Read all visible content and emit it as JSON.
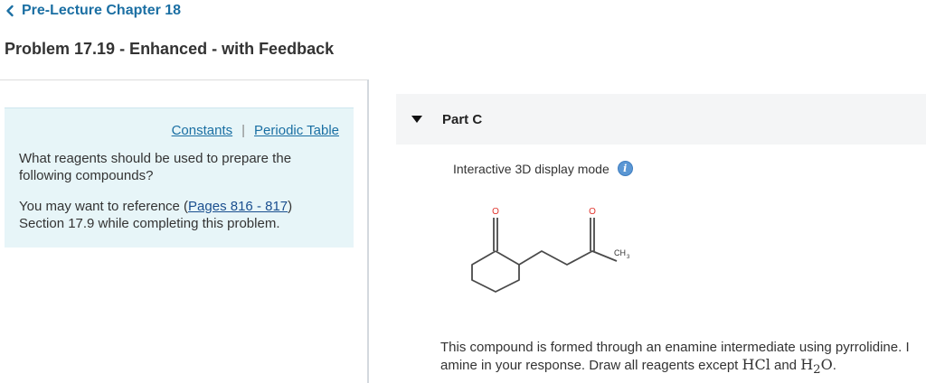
{
  "nav": {
    "back_label": "Pre-Lecture Chapter 18"
  },
  "page": {
    "title": "Problem 17.19 - Enhanced - with Feedback"
  },
  "info_panel": {
    "links": {
      "constants": "Constants",
      "separator": "|",
      "periodic_table": "Periodic Table"
    },
    "question": "What reagents should be used to prepare the following compounds?",
    "ref_prefix": "You may want to reference (",
    "ref_link": "Pages 816 - 817",
    "ref_suffix": ")",
    "ref_section": "Section 17.9 while completing this problem."
  },
  "part": {
    "label": "Part C",
    "display_mode": "Interactive 3D display mode",
    "info_icon": "i",
    "structure_labels": {
      "oxygen_1": "O",
      "oxygen_2": "O",
      "methyl_main": "CH",
      "methyl_sub": "3"
    },
    "text_line1": "This compound is formed through an enamine intermediate using pyrrolidine. I",
    "text_line2_prefix": "amine in your response. Draw all reagents except ",
    "hcl": "HCl",
    "and": " and ",
    "water_h": "H",
    "water_sub": "2",
    "water_o": "O",
    "period": "."
  },
  "colors": {
    "link": "#1b6fa3",
    "panel_bg": "#e7f5f8",
    "header_bg": "#f4f5f6",
    "oxygen": "#e0322b"
  },
  "icons": [
    "chevron-left-icon",
    "caret-down-icon",
    "info-icon"
  ]
}
